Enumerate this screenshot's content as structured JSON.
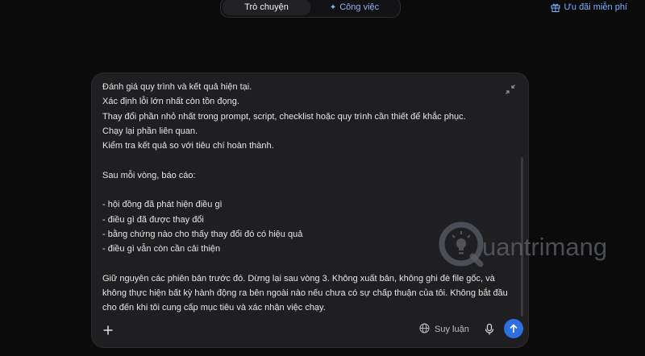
{
  "tabs": {
    "chat_label": "Trò chuyện",
    "work_label": "Công việc",
    "work_icon": "sparkle-icon"
  },
  "offer": {
    "label": "Ưu đãi miễn phí",
    "icon": "gift-icon",
    "color": "#7fb0ff"
  },
  "composer": {
    "text": "Đánh giá quy trình và kết quả hiện tại.\nXác định lỗi lớn nhất còn tồn đọng.\nThay đổi phần nhỏ nhất trong prompt, script, checklist hoặc quy trình cần thiết để khắc phục.\nChạy lại phần liên quan.\nKiểm tra kết quả so với tiêu chí hoàn thành.\n\nSau mỗi vòng, báo cáo:\n\n- hội đồng đã phát hiện điều gì\n- điều gì đã được thay đổi\n- bằng chứng nào cho thấy thay đổi đó có hiệu quả\n- điều gì vẫn còn cần cải thiện\n\nGiữ nguyên các phiên bản trước đó. Dừng lại sau vòng 3. Không xuất bản, không ghi đè file gốc, và không thực hiện bất kỳ hành động ra bên ngoài nào nếu chưa có sự chấp thuận của tôi. Không bắt đầu cho đến khi tôi cung cấp mục tiêu và xác nhận việc chạy.",
    "reasoning_label": "Suy luận",
    "accent_color": "#2f6fe0"
  },
  "watermark": {
    "brand": "uantrimang"
  }
}
